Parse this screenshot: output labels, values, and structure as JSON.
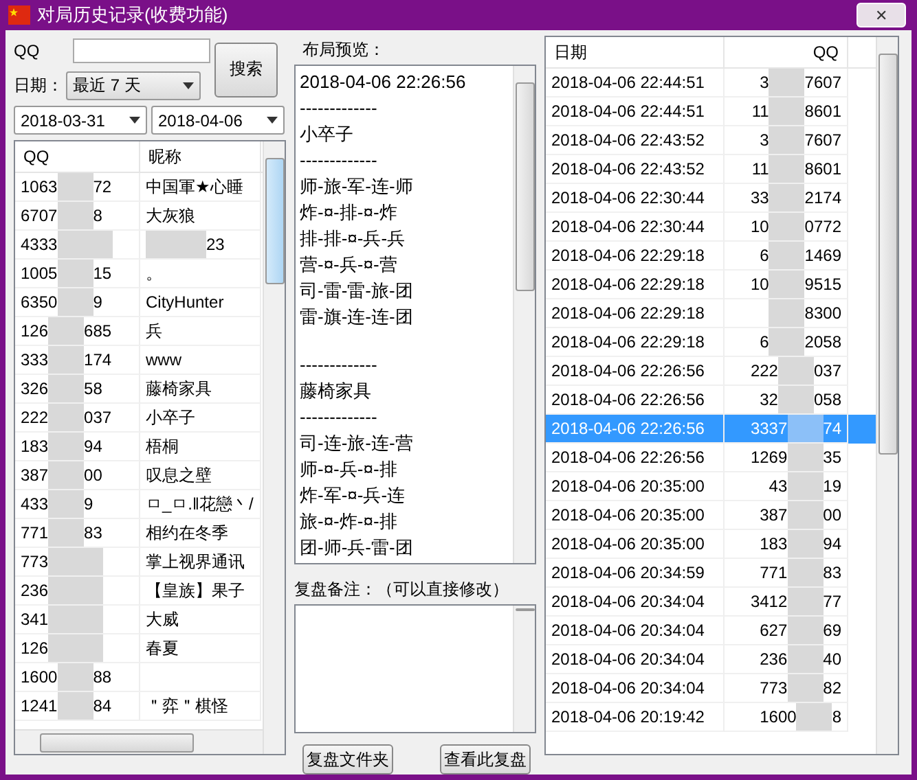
{
  "window": {
    "title": "对局历史记录(收费功能)",
    "close": "✕"
  },
  "search": {
    "qq_label": "QQ",
    "date_label": "日期：",
    "range": "最近 7 天",
    "button": "搜索",
    "from": "2018-03-31",
    "to": "2018-04-06"
  },
  "players": {
    "columns": [
      "QQ",
      "昵称"
    ],
    "rows": [
      {
        "qq_head": "1063",
        "qq_tail": "72",
        "nickname": "中国軍★心睡"
      },
      {
        "qq_head": "6707",
        "qq_tail": "8",
        "nickname": "大灰狼"
      },
      {
        "qq_head": "4333",
        "nickname": "23",
        "nickname_blurred": true
      },
      {
        "qq_head": "1005",
        "qq_tail": "15",
        "nickname": "。"
      },
      {
        "qq_head": "6350",
        "qq_tail": "9",
        "nickname": "CityHunter"
      },
      {
        "qq_head": "126",
        "qq_tail": "685",
        "nickname": "兵"
      },
      {
        "qq_head": "333",
        "qq_tail": "174",
        "nickname": "www"
      },
      {
        "qq_head": "326",
        "qq_tail": "58",
        "nickname": "藤椅家具"
      },
      {
        "qq_head": "222",
        "qq_tail": "037",
        "nickname": "小卒子"
      },
      {
        "qq_head": "183",
        "qq_tail": "94",
        "nickname": "梧桐"
      },
      {
        "qq_head": "387",
        "qq_tail": "00",
        "nickname": "叹息之壁"
      },
      {
        "qq_head": "433",
        "qq_tail": "9",
        "nickname": "ㅁ_ㅁ.‖花戀丶/"
      },
      {
        "qq_head": "771",
        "qq_tail": "83",
        "nickname": "相约在冬季"
      },
      {
        "qq_head": "773",
        "nickname": "掌上视界通讯"
      },
      {
        "qq_head": "236",
        "nickname": "【皇族】果子"
      },
      {
        "qq_head": "341",
        "nickname": "大威"
      },
      {
        "qq_head": "126",
        "nickname": "春夏"
      },
      {
        "qq_head": "1600",
        "qq_tail": "88"
      },
      {
        "qq_head": "1241",
        "qq_tail": "84",
        "nickname": "＂弈＂棋怪"
      }
    ]
  },
  "preview": {
    "label": "布局预览：",
    "sections": [
      [
        "2018-04-06 22:26:56",
        "-------------",
        "小卒子",
        "-------------",
        "师-旅-军-连-师",
        "炸-¤-排-¤-炸",
        "排-排-¤-兵-兵",
        "营-¤-兵-¤-营",
        "司-雷-雷-旅-团",
        "雷-旗-连-连-团"
      ],
      [
        "-------------",
        "藤椅家具",
        "-------------",
        "司-连-旅-连-营",
        "师-¤-兵-¤-排",
        "炸-军-¤-兵-连",
        "旅-¤-炸-¤-排",
        "团-师-兵-雷-团"
      ]
    ]
  },
  "notes": {
    "label": "复盘备注：（可以直接修改）"
  },
  "buttons": [
    "复盘文件夹",
    "查看此复盘"
  ],
  "games": {
    "columns": [
      "日期",
      "QQ"
    ],
    "rows": [
      {
        "date": "2018-04-06 22:44:51",
        "qq_head": "3",
        "qq_tail": "7607",
        "selected": false
      },
      {
        "date": "2018-04-06 22:44:51",
        "qq_head": "11",
        "qq_tail": "8601",
        "selected": false
      },
      {
        "date": "2018-04-06 22:43:52",
        "qq_head": "3",
        "qq_tail": "7607",
        "selected": false
      },
      {
        "date": "2018-04-06 22:43:52",
        "qq_head": "11",
        "qq_tail": "8601",
        "selected": false
      },
      {
        "date": "2018-04-06 22:30:44",
        "qq_head": "33",
        "qq_tail": "2174",
        "selected": false
      },
      {
        "date": "2018-04-06 22:30:44",
        "qq_head": "10",
        "qq_tail": "0772",
        "selected": false
      },
      {
        "date": "2018-04-06 22:29:18",
        "qq_head": "6",
        "qq_tail": "1469",
        "selected": false
      },
      {
        "date": "2018-04-06 22:29:18",
        "qq_head": "10",
        "qq_tail": "9515",
        "selected": false
      },
      {
        "date": "2018-04-06 22:29:18",
        "qq_tail": "8300",
        "selected": false
      },
      {
        "date": "2018-04-06 22:29:18",
        "qq_head": "6",
        "qq_tail": "2058",
        "selected": false
      },
      {
        "date": "2018-04-06 22:26:56",
        "qq_head": "222",
        "qq_tail": "037",
        "selected": false
      },
      {
        "date": "2018-04-06 22:26:56",
        "qq_head": "32",
        "qq_tail": "058",
        "selected": false
      },
      {
        "date": "2018-04-06 22:26:56",
        "qq_head": "3337",
        "qq_tail": "74",
        "selected": true
      },
      {
        "date": "2018-04-06 22:26:56",
        "qq_head": "1269",
        "qq_tail": "35",
        "selected": false
      },
      {
        "date": "2018-04-06 20:35:00",
        "qq_head": "43",
        "qq_tail": "19",
        "selected": false
      },
      {
        "date": "2018-04-06 20:35:00",
        "qq_head": "387",
        "qq_tail": "00",
        "selected": false
      },
      {
        "date": "2018-04-06 20:35:00",
        "qq_head": "183",
        "qq_tail": "94",
        "selected": false
      },
      {
        "date": "2018-04-06 20:34:59",
        "qq_head": "771",
        "qq_tail": "83",
        "selected": false
      },
      {
        "date": "2018-04-06 20:34:04",
        "qq_head": "3412",
        "qq_tail": "77",
        "selected": false
      },
      {
        "date": "2018-04-06 20:34:04",
        "qq_head": "627",
        "qq_tail": "69",
        "selected": false
      },
      {
        "date": "2018-04-06 20:34:04",
        "qq_head": "236",
        "qq_tail": "40",
        "selected": false
      },
      {
        "date": "2018-04-06 20:34:04",
        "qq_head": "773",
        "qq_tail": "82",
        "selected": false
      },
      {
        "date": "2018-04-06 20:19:42",
        "qq_head": "1600",
        "qq_tail": "8",
        "selected": false
      }
    ]
  }
}
